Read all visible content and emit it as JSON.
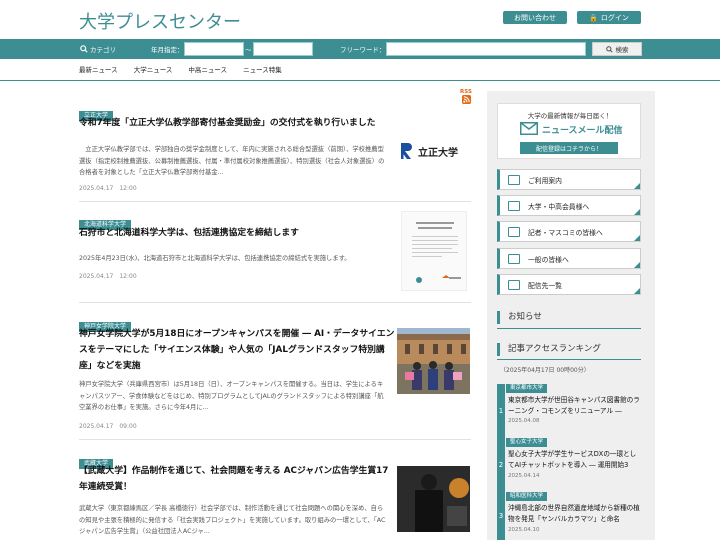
{
  "header": {
    "site_title": "大学プレスセンター",
    "contact_label": "お問い合わせ",
    "login_label": "ログイン"
  },
  "search": {
    "category_label": "カテゴリ",
    "date_label": "年月指定：",
    "date_sep": "～",
    "keyword_label": "フリーワード：",
    "search_button": "検索"
  },
  "nav": {
    "items": [
      "最新ニュース",
      "大学ニュース",
      "中高ニュース",
      "ニュース特集"
    ]
  },
  "rss_label": "RSS",
  "articles": [
    {
      "tag": "立正大学",
      "title": "令和7年度「立正大学仏教学部寄付基金奨励金」の交付式を執り行いました",
      "text": "　立正大学仏教学部では、学部独自の奨学金制度として、年内に実施される総合型選抜（前期）、学校推薦型選抜（指定校制推薦選抜、公募制推薦選抜、付属・準付属校対象推薦選抜）、特別選抜（社会人対象選抜）の合格者を対象とした「立正大学仏教学部寄付基金...",
      "date": "2025.04.17　12:00",
      "thumb_logo": "立正大学"
    },
    {
      "tag": "北海道科学大学",
      "title": "石狩市と北海道科学大学は、包括連携協定を締結します",
      "text": "2025年4月23日(水)、北海道石狩市と北海道科学大学は、包括連携協定の締結式を実施します。",
      "date": "2025.04.17　12:00"
    },
    {
      "tag": "神戸女学院大学",
      "title": "神戸女学院大学が5月18日にオープンキャンパスを開催 ― AI・データサイエンスをテーマにした「サイエンス体験」や人気の「JALグランドスタッフ特別講座」などを実施",
      "text": "神戸女学院大学（兵庫県西宮市）は5月18日（日）、オープンキャンパスを開催する。当日は、学生によるキャンパスツアー、学食体験などをはじめ、特別プログラムとしてJALのグランドスタッフによる特別講座「航空業界のお仕事」を実施。さらに今年4月に...",
      "date": "2025.04.17　09:00"
    },
    {
      "tag": "武蔵大学",
      "title": "【武蔵大学】作品制作を通じて、社会問題を考える ACジャパン広告学生賞17年連続受賞！",
      "text": "武蔵大学（東京都練馬区／学長 高橋徳行）社会学部では、制作活動を通じて社会問題への関心を深め、自らの知見や主張を積極的に発信する「社会実践プロジェクト」を実施しています。取り組みの一環として、「ACジャパン広告学生賞」（公益社団法人ACジャ..."
    }
  ],
  "sidebar": {
    "mail_head": "大学の最新情報が毎日届く！",
    "mail_title": "ニュースメール配信",
    "mail_button": "配信登録はコチラから！",
    "menu": [
      "ご利用案内",
      "大学・中高会員様へ",
      "記者・マスコミの皆様へ",
      "一般の皆様へ",
      "配信先一覧"
    ],
    "notice_heading": "お知らせ",
    "ranking_heading": "記事アクセスランキング",
    "ranking_date": "（2025年04月17日 00時00分）",
    "ranking": [
      {
        "num": "1",
        "tag": "東京都市大学",
        "title": "東京都市大学が世田谷キャンパス図書館のラーニング・コモンズをリニューアル ―",
        "date": "2025.04.08"
      },
      {
        "num": "2",
        "tag": "聖心女子大学",
        "title": "聖心女子大学が学生サービスDXの一環としてAIチャットボットを導入 ― 運用開始3",
        "date": "2025.04.14"
      },
      {
        "num": "3",
        "tag": "昭和医科大学",
        "title": "沖縄島北部の世界自然遺産地域から新種の植物を発見「ヤンバルカラマツ」と命名",
        "date": "2025.04.10"
      }
    ]
  },
  "colors": {
    "accent": "#3d8e93",
    "rss": "#e06a1b"
  }
}
